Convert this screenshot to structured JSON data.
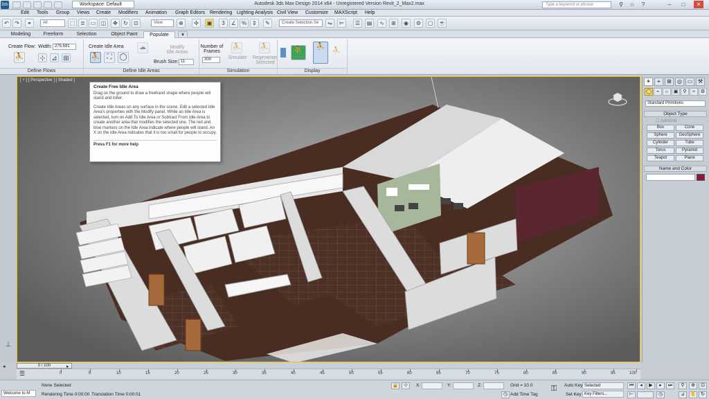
{
  "titlebar": {
    "app_icon": "3ds",
    "workspace": "Workspace: Default",
    "title": "Autodesk 3ds Max Design 2014 x64  -  Unregistered Version  Revit_2_Max2.max",
    "search_placeholder": "Type a keyword or phrase"
  },
  "menu": [
    "Edit",
    "Tools",
    "Group",
    "Views",
    "Create",
    "Modifiers",
    "Animation",
    "Graph Editors",
    "Rendering",
    "Lighting Analysis",
    "Civil View",
    "Customize",
    "MAXScript",
    "Help"
  ],
  "toolbar": {
    "selection_filter": "All",
    "view_dropdown": "View",
    "selection_set": "Create Selection Se"
  },
  "ribbon": {
    "tabs": [
      "Modeling",
      "Freeform",
      "Selection",
      "Object Paint",
      "Populate"
    ],
    "active_tab": "Populate",
    "create_flow_label": "Create Flow:",
    "width_label": "Width:",
    "width_value": "275.591",
    "create_idle_label": "Create Idle Area",
    "modify_idle_label": "Modify Idle Areas",
    "brush_size_label": "Brush Size:",
    "brush_size_value": "11",
    "frames_label": "Number of Frames",
    "frames_value": "300",
    "simulate_label": "Simulate",
    "regenerate_label": "Regenerate Selected",
    "groups": [
      "Define Flows",
      "Define Idle Areas",
      "Simulation",
      "Display"
    ]
  },
  "viewport": {
    "label": "[ + ] [ Perspective ] [ Shaded ]"
  },
  "tooltip": {
    "title": "Create Free Idle Area",
    "p1": "Drag on the ground to draw a freehand shape where people will stand and loiter.",
    "p2": "Create Idle Areas on any surface in the scene. Edit a selected Idle Area's properties with the Modify panel. While an Idle Area is selected, turn on Add To Idle Area or Subtract From Idle Area to create another area that modifies the selected one. The red and blue markers on the Idle Area indicate where people will stand. An X on the Idle Area indicates that it is too small for people to occupy.",
    "footer": "Press F1 for more help"
  },
  "command_panel": {
    "dropdown": "Standard Primitives",
    "object_type_label": "Object Type",
    "autogrid_label": "AutoGrid",
    "buttons": [
      "Box",
      "Cone",
      "Sphere",
      "GeoSphere",
      "Cylinder",
      "Tube",
      "Torus",
      "Pyramid",
      "Teapot",
      "Plane"
    ],
    "name_color_label": "Name and Color",
    "color": "#8b1a3a"
  },
  "timeline": {
    "slider": "0 / 100",
    "ticks": [
      "0",
      "5",
      "10",
      "15",
      "20",
      "25",
      "30",
      "35",
      "40",
      "45",
      "50",
      "55",
      "60",
      "65",
      "70",
      "75",
      "80",
      "85",
      "90",
      "95",
      "100"
    ]
  },
  "status": {
    "welcome": "Welcome to M",
    "selected": "None Selected",
    "rendering_label": "Rendering Time  0:00:00",
    "translation_label": "Translation Time  0:00:01",
    "x_label": "X:",
    "y_label": "Y:",
    "z_label": "Z:",
    "grid": "Grid = 10.0",
    "add_time_tag": "Add Time Tag",
    "auto_key": "Auto Key",
    "set_key": "Set Key",
    "selected_dropdown": "Selected",
    "key_filters": "Key Filters..."
  }
}
